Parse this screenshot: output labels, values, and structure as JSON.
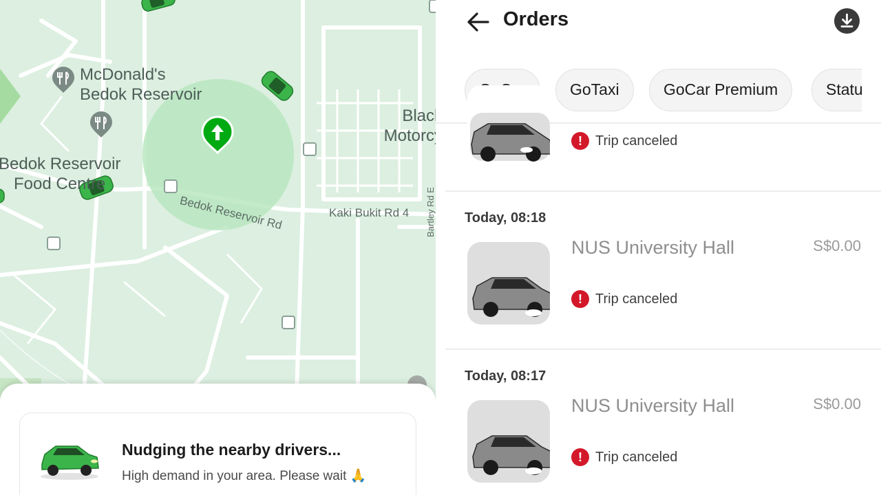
{
  "map": {
    "labels": {
      "mcdonalds_line1": "McDonald's",
      "mcdonalds_line2": "Bedok Reservoir",
      "food_centre_line1": "Bedok Reservoir",
      "food_centre_line2": "Food Centre",
      "black_line1": "Black",
      "black_line2": "Motorcy",
      "road_bedok_reservoir": "Bedok Reservoir Rd",
      "road_kaki_bukit": "Kaki Bukit Rd 4",
      "road_bartley": "Bartley Rd E"
    },
    "icons": {
      "pickup_pin": "arrow-up-pin-icon",
      "restaurant": "fork-knife-icon",
      "bus_stop": "bus-stop-icon",
      "car": "green-car-icon"
    }
  },
  "nudge": {
    "title": "Nudging the nearby drivers...",
    "subtitle": "High demand in your area. Please wait 🙏"
  },
  "orders": {
    "title": "Orders",
    "filters": [
      "GoCar",
      "GoTaxi",
      "GoCar Premium",
      "Status"
    ],
    "items": [
      {
        "date": "",
        "destination": "",
        "price": "",
        "status": "Trip canceled"
      },
      {
        "date": "Today, 08:18",
        "destination": "NUS University Hall",
        "price": "S$0.00",
        "status": "Trip canceled"
      },
      {
        "date": "Today, 08:17",
        "destination": "NUS University Hall",
        "price": "S$0.00",
        "status": "Trip canceled"
      }
    ]
  },
  "colors": {
    "map_background": "#dcefe0",
    "map_roads": "#ffffff",
    "pickup_radius": "#b8e6bf",
    "brand_green": "#00aa13",
    "cancel_red": "#d3182a",
    "chip_background": "#f4f4f4"
  }
}
